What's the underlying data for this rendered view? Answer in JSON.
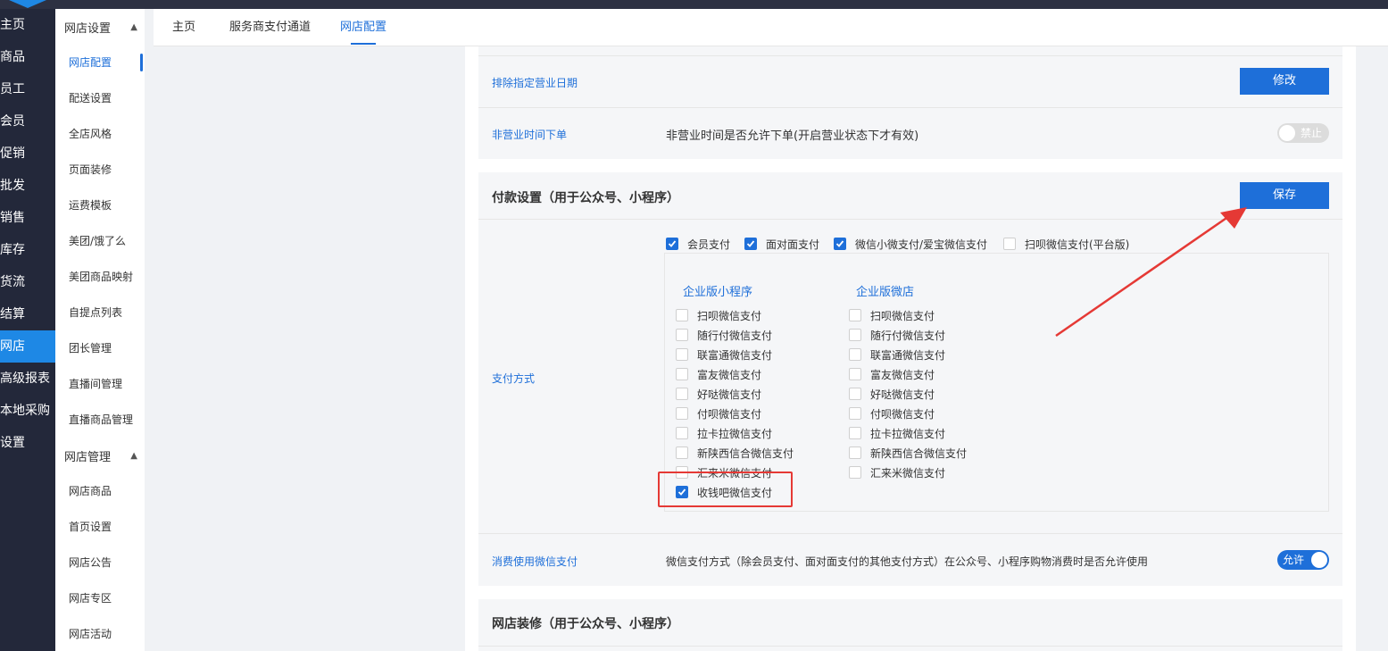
{
  "left_nav": [
    {
      "label": "主页",
      "active": false
    },
    {
      "label": "商品",
      "active": false
    },
    {
      "label": "员工",
      "active": false
    },
    {
      "label": "会员",
      "active": false
    },
    {
      "label": "促销",
      "active": false
    },
    {
      "label": "批发",
      "active": false
    },
    {
      "label": "销售",
      "active": false
    },
    {
      "label": "库存",
      "active": false
    },
    {
      "label": "货流",
      "active": false
    },
    {
      "label": "结算",
      "active": false
    },
    {
      "label": "网店",
      "active": true
    },
    {
      "label": "高级报表",
      "active": false
    },
    {
      "label": "本地采购",
      "active": false
    },
    {
      "label": "设置",
      "active": false
    }
  ],
  "sub_nav": {
    "group1": "网店设置",
    "group1_items": [
      "网店配置",
      "配送设置",
      "全店风格",
      "页面装修",
      "运费模板",
      "美团/饿了么",
      "美团商品映射",
      "自提点列表",
      "团长管理",
      "直播间管理",
      "直播商品管理"
    ],
    "group2": "网店管理",
    "group2_items": [
      "网店商品",
      "首页设置",
      "网店公告",
      "网店专区",
      "网店活动"
    ]
  },
  "tabs": [
    "主页",
    "服务商支付通道",
    "网店配置"
  ],
  "rows": {
    "exclude_dates": {
      "label": "排除指定营业日期",
      "button": "修改"
    },
    "off_hours": {
      "label": "非营业时间下单",
      "desc": "非营业时间是否允许下单(开启营业状态下才有效)",
      "toggle": "禁止"
    }
  },
  "payment": {
    "title": "付款设置（用于公众号、小程序）",
    "save": "保存",
    "method_label": "支付方式",
    "top_options": [
      {
        "label": "会员支付",
        "checked": true
      },
      {
        "label": "面对面支付",
        "checked": true
      },
      {
        "label": "微信小微支付/爱宝微信支付",
        "checked": true
      },
      {
        "label": "扫呗微信支付(平台版)",
        "checked": false
      }
    ],
    "col1_title": "企业版小程序",
    "col2_title": "企业版微店",
    "col1": [
      {
        "label": "扫呗微信支付",
        "checked": false
      },
      {
        "label": "随行付微信支付",
        "checked": false
      },
      {
        "label": "联富通微信支付",
        "checked": false
      },
      {
        "label": "富友微信支付",
        "checked": false
      },
      {
        "label": "好哒微信支付",
        "checked": false
      },
      {
        "label": "付呗微信支付",
        "checked": false
      },
      {
        "label": "拉卡拉微信支付",
        "checked": false
      },
      {
        "label": "新陕西信合微信支付",
        "checked": false
      },
      {
        "label": "汇来米微信支付",
        "checked": false
      },
      {
        "label": "收钱吧微信支付",
        "checked": true
      }
    ],
    "col2": [
      {
        "label": "扫呗微信支付",
        "checked": false
      },
      {
        "label": "随行付微信支付",
        "checked": false
      },
      {
        "label": "联富通微信支付",
        "checked": false
      },
      {
        "label": "富友微信支付",
        "checked": false
      },
      {
        "label": "好哒微信支付",
        "checked": false
      },
      {
        "label": "付呗微信支付",
        "checked": false
      },
      {
        "label": "拉卡拉微信支付",
        "checked": false
      },
      {
        "label": "新陕西信合微信支付",
        "checked": false
      },
      {
        "label": "汇来米微信支付",
        "checked": false
      }
    ],
    "consume_label": "消费使用微信支付",
    "consume_desc": "微信支付方式（除会员支付、面对面支付的其他支付方式）在公众号、小程序购物消费时是否允许使用",
    "consume_toggle": "允许"
  },
  "decor": {
    "title": "网店装修（用于公众号、小程序）"
  },
  "colors": {
    "primary": "#1e6fd9",
    "nav_bg": "#23283a",
    "active_nav": "#1e88e5",
    "annotation": "#e53935"
  }
}
